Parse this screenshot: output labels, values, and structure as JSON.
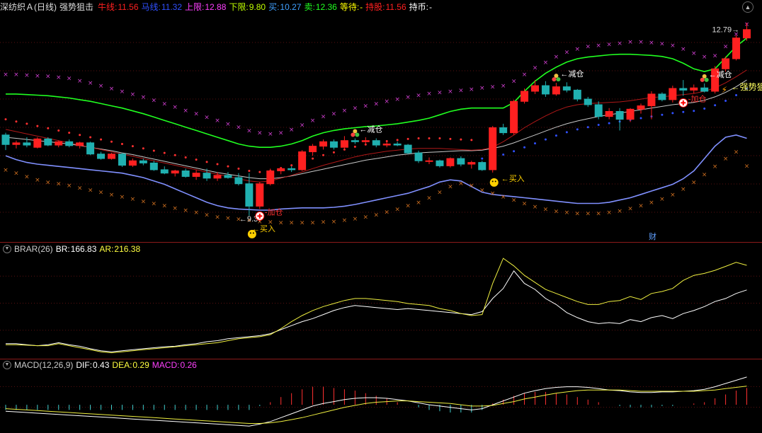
{
  "header": {
    "stock": "深纺织Ａ",
    "period": "(日线)",
    "indicator": "强势狙击",
    "bull_label": "牛线:",
    "bull_value": "11.56",
    "horse_label": "马线:",
    "horse_value": "11.32",
    "upper_label": "上限:",
    "upper_value": "12.88",
    "lower_label": "下限:",
    "lower_value": "9.80",
    "buy_label": "买:",
    "buy_value": "10.27",
    "sell_label": "卖:",
    "sell_value": "12.36",
    "wait_label": "等待:",
    "wait_value": "-",
    "hold_label": "持股:",
    "hold_value": "11.56",
    "coin_label": "持币:",
    "coin_value": "-"
  },
  "brar": {
    "name": "BRAR(26)",
    "br_label": "BR:",
    "br_value": "166.83",
    "ar_label": "AR:",
    "ar_value": "216.38"
  },
  "macd": {
    "name": "MACD(12,26,9)",
    "dif_label": "DIF:",
    "dif_value": "0.43",
    "dea_label": "DEA:",
    "dea_value": "0.29",
    "macd_label": "MACD:",
    "macd_value": "0.26"
  },
  "colors": {
    "up": "#ff2020",
    "down": "#20b0b0",
    "bull": "#ff2020",
    "horse": "#3050ff",
    "upper": "#ff40ff",
    "lower": "#c0ff00",
    "buy": "#40a0ff",
    "sell": "#20ff20",
    "wait": "#ffff00",
    "hold": "#ff2020",
    "coin": "#ffffff",
    "divider": "#8b1a1a"
  },
  "chart_data": {
    "type": "candlestick",
    "ylim": [
      9.0,
      12.95
    ],
    "candles": [
      {
        "o": 10.82,
        "h": 10.86,
        "l": 10.55,
        "c": 10.65
      },
      {
        "o": 10.65,
        "h": 10.72,
        "l": 10.58,
        "c": 10.68
      },
      {
        "o": 10.68,
        "h": 10.78,
        "l": 10.6,
        "c": 10.64
      },
      {
        "o": 10.6,
        "h": 10.78,
        "l": 10.58,
        "c": 10.75
      },
      {
        "o": 10.75,
        "h": 10.78,
        "l": 10.62,
        "c": 10.64
      },
      {
        "o": 10.64,
        "h": 10.72,
        "l": 10.6,
        "c": 10.7
      },
      {
        "o": 10.7,
        "h": 10.74,
        "l": 10.6,
        "c": 10.63
      },
      {
        "o": 10.63,
        "h": 10.7,
        "l": 10.58,
        "c": 10.68
      },
      {
        "o": 10.68,
        "h": 10.7,
        "l": 10.46,
        "c": 10.48
      },
      {
        "o": 10.48,
        "h": 10.52,
        "l": 10.38,
        "c": 10.4
      },
      {
        "o": 10.4,
        "h": 10.5,
        "l": 10.38,
        "c": 10.48
      },
      {
        "o": 10.48,
        "h": 10.5,
        "l": 10.25,
        "c": 10.28
      },
      {
        "o": 10.28,
        "h": 10.4,
        "l": 10.25,
        "c": 10.36
      },
      {
        "o": 10.36,
        "h": 10.4,
        "l": 10.28,
        "c": 10.32
      },
      {
        "o": 10.32,
        "h": 10.36,
        "l": 10.18,
        "c": 10.2
      },
      {
        "o": 10.2,
        "h": 10.26,
        "l": 10.12,
        "c": 10.14
      },
      {
        "o": 10.14,
        "h": 10.2,
        "l": 10.08,
        "c": 10.18
      },
      {
        "o": 10.18,
        "h": 10.22,
        "l": 10.06,
        "c": 10.08
      },
      {
        "o": 10.08,
        "h": 10.2,
        "l": 10.02,
        "c": 10.14
      },
      {
        "o": 10.14,
        "h": 10.22,
        "l": 10.0,
        "c": 10.05
      },
      {
        "o": 10.05,
        "h": 10.16,
        "l": 10.0,
        "c": 10.1
      },
      {
        "o": 10.1,
        "h": 10.16,
        "l": 10.04,
        "c": 10.06
      },
      {
        "o": 10.06,
        "h": 10.14,
        "l": 9.92,
        "c": 9.95
      },
      {
        "o": 9.95,
        "h": 10.14,
        "l": 9.38,
        "c": 9.55
      },
      {
        "o": 9.55,
        "h": 9.98,
        "l": 9.5,
        "c": 9.95
      },
      {
        "o": 9.95,
        "h": 10.22,
        "l": 9.92,
        "c": 10.18
      },
      {
        "o": 10.18,
        "h": 10.25,
        "l": 10.12,
        "c": 10.22
      },
      {
        "o": 10.22,
        "h": 10.26,
        "l": 10.16,
        "c": 10.2
      },
      {
        "o": 10.2,
        "h": 10.55,
        "l": 10.18,
        "c": 10.52
      },
      {
        "o": 10.52,
        "h": 10.66,
        "l": 10.45,
        "c": 10.62
      },
      {
        "o": 10.62,
        "h": 10.74,
        "l": 10.56,
        "c": 10.7
      },
      {
        "o": 10.7,
        "h": 10.74,
        "l": 10.56,
        "c": 10.6
      },
      {
        "o": 10.6,
        "h": 10.8,
        "l": 10.58,
        "c": 10.72
      },
      {
        "o": 10.72,
        "h": 10.76,
        "l": 10.66,
        "c": 10.7
      },
      {
        "o": 10.7,
        "h": 10.78,
        "l": 10.66,
        "c": 10.72
      },
      {
        "o": 10.72,
        "h": 10.76,
        "l": 10.6,
        "c": 10.64
      },
      {
        "o": 10.64,
        "h": 10.7,
        "l": 10.6,
        "c": 10.66
      },
      {
        "o": 10.66,
        "h": 10.7,
        "l": 10.62,
        "c": 10.64
      },
      {
        "o": 10.64,
        "h": 10.66,
        "l": 10.48,
        "c": 10.5
      },
      {
        "o": 10.5,
        "h": 10.54,
        "l": 10.32,
        "c": 10.36
      },
      {
        "o": 10.36,
        "h": 10.42,
        "l": 10.3,
        "c": 10.36
      },
      {
        "o": 10.36,
        "h": 10.38,
        "l": 10.24,
        "c": 10.27
      },
      {
        "o": 10.27,
        "h": 10.42,
        "l": 10.24,
        "c": 10.4
      },
      {
        "o": 10.4,
        "h": 10.44,
        "l": 10.26,
        "c": 10.3
      },
      {
        "o": 10.3,
        "h": 10.36,
        "l": 10.22,
        "c": 10.33
      },
      {
        "o": 10.33,
        "h": 10.36,
        "l": 10.18,
        "c": 10.2
      },
      {
        "o": 10.2,
        "h": 10.98,
        "l": 10.15,
        "c": 10.95
      },
      {
        "o": 10.95,
        "h": 11.02,
        "l": 10.82,
        "c": 10.86
      },
      {
        "o": 10.86,
        "h": 11.45,
        "l": 10.82,
        "c": 11.42
      },
      {
        "o": 11.42,
        "h": 11.65,
        "l": 11.38,
        "c": 11.6
      },
      {
        "o": 11.6,
        "h": 11.8,
        "l": 11.55,
        "c": 11.7
      },
      {
        "o": 11.7,
        "h": 11.78,
        "l": 11.5,
        "c": 11.55
      },
      {
        "o": 11.55,
        "h": 11.75,
        "l": 11.52,
        "c": 11.68
      },
      {
        "o": 11.68,
        "h": 11.76,
        "l": 11.58,
        "c": 11.62
      },
      {
        "o": 11.62,
        "h": 11.64,
        "l": 11.42,
        "c": 11.46
      },
      {
        "o": 11.46,
        "h": 11.5,
        "l": 11.32,
        "c": 11.36
      },
      {
        "o": 11.36,
        "h": 11.42,
        "l": 11.1,
        "c": 11.15
      },
      {
        "o": 11.15,
        "h": 11.3,
        "l": 11.1,
        "c": 11.24
      },
      {
        "o": 11.24,
        "h": 11.3,
        "l": 10.9,
        "c": 11.1
      },
      {
        "o": 11.1,
        "h": 11.3,
        "l": 11.05,
        "c": 11.28
      },
      {
        "o": 11.28,
        "h": 11.38,
        "l": 11.2,
        "c": 11.34
      },
      {
        "o": 11.34,
        "h": 11.6,
        "l": 11.1,
        "c": 11.55
      },
      {
        "o": 11.55,
        "h": 11.58,
        "l": 11.42,
        "c": 11.45
      },
      {
        "o": 11.45,
        "h": 11.7,
        "l": 11.4,
        "c": 11.65
      },
      {
        "o": 11.65,
        "h": 11.8,
        "l": 11.52,
        "c": 11.62
      },
      {
        "o": 11.62,
        "h": 11.72,
        "l": 11.56,
        "c": 11.66
      },
      {
        "o": 11.66,
        "h": 11.74,
        "l": 11.58,
        "c": 11.6
      },
      {
        "o": 11.6,
        "h": 12.05,
        "l": 11.56,
        "c": 12.0
      },
      {
        "o": 12.0,
        "h": 12.22,
        "l": 11.95,
        "c": 12.18
      },
      {
        "o": 12.18,
        "h": 12.6,
        "l": 12.15,
        "c": 12.55
      },
      {
        "o": 12.55,
        "h": 12.82,
        "l": 12.5,
        "c": 12.7
      }
    ],
    "bull_line": [
      10.92,
      10.88,
      10.84,
      10.8,
      10.76,
      10.72,
      10.68,
      10.64,
      10.6,
      10.56,
      10.52,
      10.48,
      10.44,
      10.4,
      10.36,
      10.32,
      10.28,
      10.24,
      10.2,
      10.16,
      10.12,
      10.08,
      10.04,
      10.0,
      9.98,
      10.0,
      10.05,
      10.1,
      10.16,
      10.22,
      10.28,
      10.33,
      10.38,
      10.43,
      10.47,
      10.5,
      10.53,
      10.55,
      10.57,
      10.58,
      10.58,
      10.58,
      10.57,
      10.56,
      10.55,
      10.56,
      10.6,
      10.7,
      10.82,
      10.95,
      11.06,
      11.16,
      11.25,
      11.32,
      11.36,
      11.38,
      11.39,
      11.4,
      11.41,
      11.43,
      11.46,
      11.49,
      11.5,
      11.52,
      11.54,
      11.56,
      11.6,
      11.66,
      11.75,
      11.86,
      11.98
    ],
    "horse_line": [
      10.78,
      10.76,
      10.74,
      10.72,
      10.7,
      10.68,
      10.66,
      10.63,
      10.6,
      10.57,
      10.54,
      10.5,
      10.47,
      10.43,
      10.39,
      10.35,
      10.31,
      10.27,
      10.23,
      10.19,
      10.15,
      10.12,
      10.09,
      10.06,
      10.04,
      10.04,
      10.06,
      10.09,
      10.13,
      10.17,
      10.21,
      10.25,
      10.29,
      10.33,
      10.37,
      10.4,
      10.43,
      10.46,
      10.48,
      10.5,
      10.51,
      10.52,
      10.53,
      10.54,
      10.54,
      10.55,
      10.58,
      10.62,
      10.68,
      10.75,
      10.82,
      10.89,
      10.96,
      11.02,
      11.07,
      11.11,
      11.15,
      11.18,
      11.21,
      11.24,
      11.27,
      11.3,
      11.33,
      11.36,
      11.38,
      11.4,
      11.44,
      11.5,
      11.58,
      11.68,
      11.8
    ],
    "upper_band": [
      11.55,
      11.55,
      11.54,
      11.53,
      11.52,
      11.5,
      11.48,
      11.45,
      11.42,
      11.38,
      11.34,
      11.3,
      11.25,
      11.2,
      11.14,
      11.08,
      11.02,
      10.96,
      10.9,
      10.84,
      10.78,
      10.72,
      10.66,
      10.62,
      10.6,
      10.6,
      10.62,
      10.66,
      10.72,
      10.8,
      10.86,
      10.9,
      10.93,
      10.95,
      10.97,
      10.98,
      11.0,
      11.02,
      11.05,
      11.08,
      11.12,
      11.18,
      11.24,
      11.28,
      11.3,
      11.3,
      11.3,
      11.3,
      11.4,
      11.6,
      11.78,
      11.92,
      12.03,
      12.12,
      12.18,
      12.21,
      12.23,
      12.25,
      12.26,
      12.26,
      12.25,
      12.24,
      12.22,
      12.18,
      12.1,
      12.0,
      11.95,
      12.0,
      12.2,
      12.4,
      12.55
    ],
    "lower_band": [
      10.45,
      10.38,
      10.33,
      10.3,
      10.28,
      10.26,
      10.24,
      10.22,
      10.2,
      10.18,
      10.16,
      10.14,
      10.1,
      10.06,
      10.0,
      9.94,
      9.86,
      9.78,
      9.7,
      9.62,
      9.56,
      9.52,
      9.5,
      9.49,
      9.48,
      9.48,
      9.5,
      9.51,
      9.52,
      9.52,
      9.52,
      9.53,
      9.55,
      9.58,
      9.62,
      9.66,
      9.7,
      9.74,
      9.78,
      9.84,
      9.9,
      9.98,
      10.02,
      10.0,
      9.9,
      9.8,
      9.76,
      9.74,
      9.72,
      9.7,
      9.68,
      9.66,
      9.64,
      9.62,
      9.6,
      9.6,
      9.6,
      9.62,
      9.66,
      9.7,
      9.76,
      9.82,
      9.88,
      9.94,
      10.04,
      10.18,
      10.4,
      10.62,
      10.78,
      10.82,
      10.76
    ],
    "sell_line": [
      11.9,
      11.9,
      11.89,
      11.88,
      11.87,
      11.85,
      11.83,
      11.79,
      11.75,
      11.7,
      11.65,
      11.6,
      11.55,
      11.5,
      11.44,
      11.38,
      11.32,
      11.26,
      11.2,
      11.14,
      11.08,
      11.02,
      10.96,
      10.9,
      10.86,
      10.84,
      10.86,
      10.92,
      11.0,
      11.08,
      11.15,
      11.2,
      11.26,
      11.3,
      11.34,
      11.38,
      11.42,
      11.46,
      11.5,
      11.53,
      11.56,
      11.58,
      11.6,
      11.62,
      11.64,
      11.66,
      11.68,
      11.7,
      11.78,
      11.9,
      12.02,
      12.12,
      12.22,
      12.3,
      12.36,
      12.4,
      12.42,
      12.44,
      12.46,
      12.48,
      12.48,
      12.47,
      12.45,
      12.42,
      12.36,
      12.28,
      12.22,
      12.24,
      12.4,
      12.62,
      12.8
    ],
    "buy_line": [
      10.2,
      10.14,
      10.08,
      10.02,
      9.98,
      9.95,
      9.92,
      9.88,
      9.84,
      9.8,
      9.76,
      9.72,
      9.68,
      9.64,
      9.6,
      9.56,
      9.52,
      9.48,
      9.44,
      9.4,
      9.36,
      9.34,
      9.32,
      9.3,
      9.28,
      9.27,
      9.26,
      9.26,
      9.26,
      9.26,
      9.27,
      9.28,
      9.3,
      9.33,
      9.36,
      9.4,
      9.45,
      9.5,
      9.56,
      9.62,
      9.7,
      9.8,
      9.9,
      9.96,
      9.92,
      9.84,
      9.78,
      9.72,
      9.66,
      9.6,
      9.54,
      9.5,
      9.46,
      9.44,
      9.42,
      9.42,
      9.42,
      9.44,
      9.47,
      9.51,
      9.56,
      9.62,
      9.68,
      9.76,
      9.86,
      9.98,
      10.12,
      10.26,
      10.4,
      10.52,
      10.27
    ],
    "annotations": [
      {
        "i": 23,
        "text": "9.37",
        "kind": "low"
      },
      {
        "i": 69,
        "text": "12.79",
        "kind": "high"
      },
      {
        "i": 24,
        "text": "加仓",
        "kind": "add"
      },
      {
        "i": 64,
        "text": "加仓",
        "kind": "add"
      },
      {
        "i": 23,
        "text": "买入",
        "kind": "buy"
      },
      {
        "i": 46,
        "text": "买入",
        "kind": "buy"
      },
      {
        "i": 33,
        "text": "减仓",
        "kind": "reduce"
      },
      {
        "i": 52,
        "text": "减仓",
        "kind": "reduce"
      },
      {
        "i": 66,
        "text": "减仓",
        "kind": "reduce"
      },
      {
        "i": 68,
        "text": "强势狙击",
        "kind": "snipe"
      }
    ],
    "cai_label": "财",
    "brar_panel": {
      "ylim": [
        40,
        240
      ],
      "br": [
        60,
        60,
        58,
        56,
        58,
        62,
        58,
        55,
        50,
        46,
        44,
        46,
        48,
        50,
        52,
        54,
        55,
        58,
        60,
        64,
        66,
        70,
        72,
        74,
        76,
        80,
        88,
        96,
        104,
        110,
        118,
        126,
        132,
        136,
        134,
        132,
        130,
        128,
        130,
        128,
        126,
        124,
        122,
        120,
        118,
        124,
        150,
        170,
        205,
        180,
        168,
        150,
        138,
        122,
        112,
        104,
        100,
        102,
        100,
        108,
        104,
        112,
        116,
        110,
        120,
        126,
        134,
        144,
        150,
        160,
        167
      ],
      "ar": [
        58,
        58,
        57,
        56,
        56,
        60,
        56,
        52,
        48,
        44,
        42,
        44,
        46,
        48,
        50,
        52,
        54,
        56,
        58,
        60,
        62,
        66,
        70,
        72,
        74,
        78,
        90,
        104,
        116,
        126,
        134,
        140,
        146,
        150,
        150,
        148,
        146,
        144,
        140,
        138,
        136,
        130,
        126,
        120,
        116,
        118,
        180,
        230,
        215,
        196,
        182,
        168,
        160,
        152,
        144,
        138,
        138,
        144,
        146,
        154,
        148,
        160,
        164,
        170,
        186,
        196,
        200,
        206,
        214,
        222,
        216
      ]
    },
    "macd_panel": {
      "ylim": [
        -0.35,
        0.55
      ],
      "dif": [
        -0.1,
        -0.11,
        -0.12,
        -0.13,
        -0.14,
        -0.15,
        -0.16,
        -0.17,
        -0.18,
        -0.19,
        -0.2,
        -0.21,
        -0.22,
        -0.23,
        -0.24,
        -0.25,
        -0.26,
        -0.27,
        -0.28,
        -0.29,
        -0.3,
        -0.31,
        -0.32,
        -0.33,
        -0.3,
        -0.26,
        -0.2,
        -0.14,
        -0.08,
        -0.02,
        0.02,
        0.05,
        0.08,
        0.1,
        0.11,
        0.11,
        0.1,
        0.08,
        0.06,
        0.03,
        0.0,
        -0.02,
        -0.04,
        -0.06,
        -0.08,
        -0.06,
        0.0,
        0.06,
        0.12,
        0.18,
        0.22,
        0.25,
        0.27,
        0.28,
        0.28,
        0.27,
        0.25,
        0.23,
        0.22,
        0.2,
        0.19,
        0.19,
        0.2,
        0.2,
        0.21,
        0.22,
        0.24,
        0.28,
        0.33,
        0.38,
        0.43
      ],
      "dea": [
        -0.06,
        -0.07,
        -0.08,
        -0.09,
        -0.1,
        -0.11,
        -0.12,
        -0.13,
        -0.14,
        -0.15,
        -0.16,
        -0.17,
        -0.18,
        -0.19,
        -0.2,
        -0.21,
        -0.22,
        -0.23,
        -0.24,
        -0.25,
        -0.26,
        -0.27,
        -0.28,
        -0.29,
        -0.29,
        -0.28,
        -0.26,
        -0.23,
        -0.2,
        -0.16,
        -0.12,
        -0.08,
        -0.04,
        -0.01,
        0.02,
        0.04,
        0.05,
        0.06,
        0.06,
        0.05,
        0.04,
        0.03,
        0.02,
        0.0,
        -0.02,
        -0.02,
        -0.01,
        0.02,
        0.05,
        0.09,
        0.12,
        0.15,
        0.18,
        0.2,
        0.22,
        0.23,
        0.23,
        0.23,
        0.23,
        0.22,
        0.21,
        0.21,
        0.21,
        0.21,
        0.21,
        0.21,
        0.22,
        0.23,
        0.25,
        0.27,
        0.29
      ],
      "macd": [
        -0.08,
        -0.08,
        -0.08,
        -0.08,
        -0.08,
        -0.08,
        -0.08,
        -0.08,
        -0.08,
        -0.08,
        -0.08,
        -0.08,
        -0.08,
        -0.08,
        -0.08,
        -0.08,
        -0.08,
        -0.08,
        -0.08,
        -0.08,
        -0.08,
        -0.08,
        -0.08,
        -0.08,
        -0.02,
        0.04,
        0.12,
        0.18,
        0.24,
        0.28,
        0.28,
        0.26,
        0.24,
        0.22,
        0.18,
        0.14,
        0.1,
        0.04,
        0.0,
        -0.04,
        -0.08,
        -0.1,
        -0.12,
        -0.12,
        -0.12,
        -0.08,
        0.02,
        0.08,
        0.14,
        0.18,
        0.2,
        0.2,
        0.18,
        0.16,
        0.12,
        0.08,
        0.04,
        0.0,
        -0.02,
        -0.04,
        -0.04,
        -0.04,
        -0.02,
        -0.02,
        0.0,
        0.02,
        0.04,
        0.1,
        0.16,
        0.22,
        0.26
      ]
    }
  }
}
